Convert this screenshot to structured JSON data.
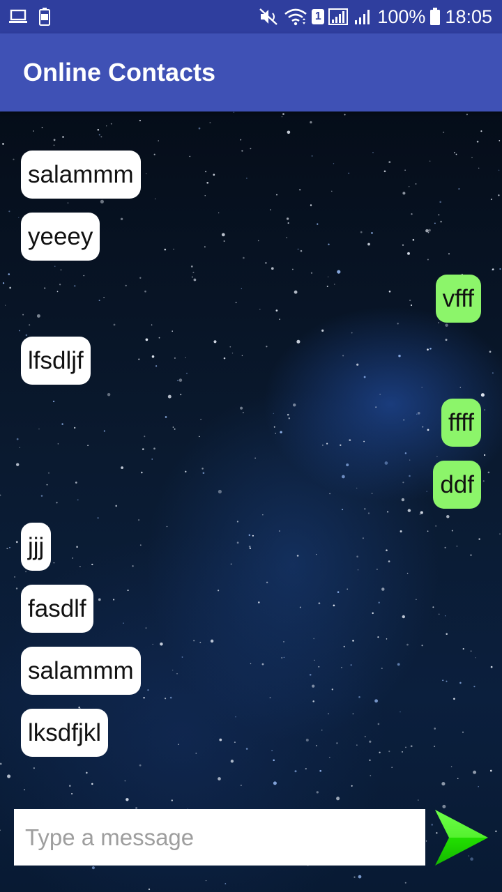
{
  "status_bar": {
    "battery_percent": "100%",
    "time": "18:05",
    "sim_slot": "1",
    "left_icons": [
      "laptop-icon",
      "battery-saver-icon"
    ],
    "right_icons": [
      "mute-vibrate-icon",
      "wifi-icon",
      "sim-slot-icon",
      "signal-icon",
      "signal-icon-2",
      "battery-icon"
    ]
  },
  "app_bar": {
    "title": "Online Contacts",
    "color": "#3f51b5"
  },
  "messages": [
    {
      "text": "salammm",
      "direction": "incoming"
    },
    {
      "text": "yeeey",
      "direction": "incoming"
    },
    {
      "text": "vfff",
      "direction": "outgoing"
    },
    {
      "text": "lfsdljf",
      "direction": "incoming"
    },
    {
      "text": "ffff",
      "direction": "outgoing"
    },
    {
      "text": "ddf",
      "direction": "outgoing"
    },
    {
      "text": "jjj",
      "direction": "incoming"
    },
    {
      "text": "fasdlf",
      "direction": "incoming"
    },
    {
      "text": "salammm",
      "direction": "incoming"
    },
    {
      "text": "lksdfjkl",
      "direction": "incoming"
    }
  ],
  "composer": {
    "placeholder": "Type a message",
    "value": "",
    "send_icon": "send-arrow-icon"
  },
  "colors": {
    "incoming_bubble": "#ffffff",
    "outgoing_bubble": "#8cf56a",
    "send_arrow": "#22e000"
  }
}
